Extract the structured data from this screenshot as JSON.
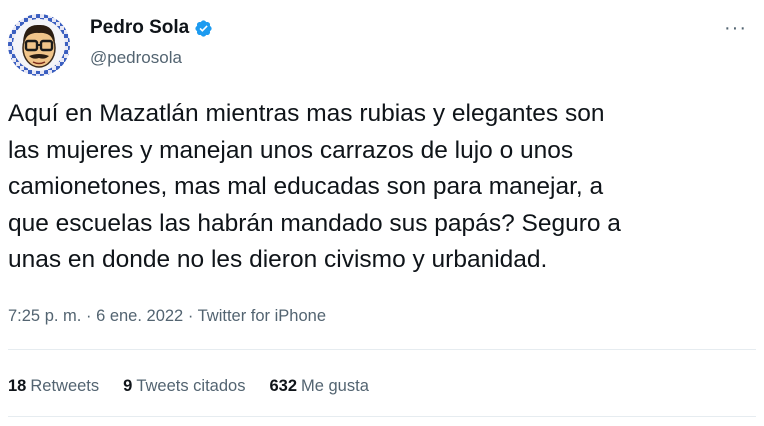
{
  "user": {
    "display_name": "Pedro Sola",
    "handle": "@pedrosola",
    "verified": true
  },
  "tweet": {
    "text": "Aquí en Mazatlán mientras mas rubias y elegantes son\nlas mujeres y manejan unos carrazos de lujo o unos\ncamionetones, mas mal educadas son para manejar, a\nque escuelas las habrán mandado sus papás? Seguro a\nunas en donde no les dieron civismo y urbanidad.",
    "time": "7:25 p. m.",
    "separator": "·",
    "date": "6 ene. 2022",
    "source": "Twitter for iPhone"
  },
  "stats": {
    "retweets_count": "18",
    "retweets_label": "Retweets",
    "quotes_count": "9",
    "quotes_label": "Tweets citados",
    "likes_count": "632",
    "likes_label": "Me gusta"
  },
  "icons": {
    "verified": "verified-badge-icon",
    "more": "more-options-icon"
  },
  "colors": {
    "verified_blue": "#1d9bf0",
    "secondary_text": "#536471",
    "primary_text": "#0f1419",
    "divider": "#e6ecf0"
  }
}
